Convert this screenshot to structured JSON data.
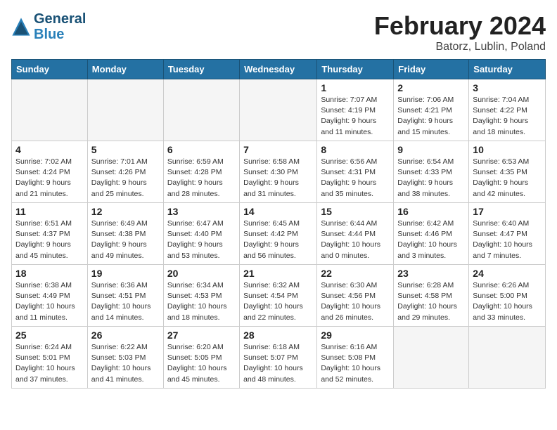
{
  "header": {
    "logo_line1": "General",
    "logo_line2": "Blue",
    "month_title": "February 2024",
    "location": "Batorz, Lublin, Poland"
  },
  "days_of_week": [
    "Sunday",
    "Monday",
    "Tuesday",
    "Wednesday",
    "Thursday",
    "Friday",
    "Saturday"
  ],
  "weeks": [
    [
      {
        "day": "",
        "info": ""
      },
      {
        "day": "",
        "info": ""
      },
      {
        "day": "",
        "info": ""
      },
      {
        "day": "",
        "info": ""
      },
      {
        "day": "1",
        "info": "Sunrise: 7:07 AM\nSunset: 4:19 PM\nDaylight: 9 hours\nand 11 minutes."
      },
      {
        "day": "2",
        "info": "Sunrise: 7:06 AM\nSunset: 4:21 PM\nDaylight: 9 hours\nand 15 minutes."
      },
      {
        "day": "3",
        "info": "Sunrise: 7:04 AM\nSunset: 4:22 PM\nDaylight: 9 hours\nand 18 minutes."
      }
    ],
    [
      {
        "day": "4",
        "info": "Sunrise: 7:02 AM\nSunset: 4:24 PM\nDaylight: 9 hours\nand 21 minutes."
      },
      {
        "day": "5",
        "info": "Sunrise: 7:01 AM\nSunset: 4:26 PM\nDaylight: 9 hours\nand 25 minutes."
      },
      {
        "day": "6",
        "info": "Sunrise: 6:59 AM\nSunset: 4:28 PM\nDaylight: 9 hours\nand 28 minutes."
      },
      {
        "day": "7",
        "info": "Sunrise: 6:58 AM\nSunset: 4:30 PM\nDaylight: 9 hours\nand 31 minutes."
      },
      {
        "day": "8",
        "info": "Sunrise: 6:56 AM\nSunset: 4:31 PM\nDaylight: 9 hours\nand 35 minutes."
      },
      {
        "day": "9",
        "info": "Sunrise: 6:54 AM\nSunset: 4:33 PM\nDaylight: 9 hours\nand 38 minutes."
      },
      {
        "day": "10",
        "info": "Sunrise: 6:53 AM\nSunset: 4:35 PM\nDaylight: 9 hours\nand 42 minutes."
      }
    ],
    [
      {
        "day": "11",
        "info": "Sunrise: 6:51 AM\nSunset: 4:37 PM\nDaylight: 9 hours\nand 45 minutes."
      },
      {
        "day": "12",
        "info": "Sunrise: 6:49 AM\nSunset: 4:38 PM\nDaylight: 9 hours\nand 49 minutes."
      },
      {
        "day": "13",
        "info": "Sunrise: 6:47 AM\nSunset: 4:40 PM\nDaylight: 9 hours\nand 53 minutes."
      },
      {
        "day": "14",
        "info": "Sunrise: 6:45 AM\nSunset: 4:42 PM\nDaylight: 9 hours\nand 56 minutes."
      },
      {
        "day": "15",
        "info": "Sunrise: 6:44 AM\nSunset: 4:44 PM\nDaylight: 10 hours\nand 0 minutes."
      },
      {
        "day": "16",
        "info": "Sunrise: 6:42 AM\nSunset: 4:46 PM\nDaylight: 10 hours\nand 3 minutes."
      },
      {
        "day": "17",
        "info": "Sunrise: 6:40 AM\nSunset: 4:47 PM\nDaylight: 10 hours\nand 7 minutes."
      }
    ],
    [
      {
        "day": "18",
        "info": "Sunrise: 6:38 AM\nSunset: 4:49 PM\nDaylight: 10 hours\nand 11 minutes."
      },
      {
        "day": "19",
        "info": "Sunrise: 6:36 AM\nSunset: 4:51 PM\nDaylight: 10 hours\nand 14 minutes."
      },
      {
        "day": "20",
        "info": "Sunrise: 6:34 AM\nSunset: 4:53 PM\nDaylight: 10 hours\nand 18 minutes."
      },
      {
        "day": "21",
        "info": "Sunrise: 6:32 AM\nSunset: 4:54 PM\nDaylight: 10 hours\nand 22 minutes."
      },
      {
        "day": "22",
        "info": "Sunrise: 6:30 AM\nSunset: 4:56 PM\nDaylight: 10 hours\nand 26 minutes."
      },
      {
        "day": "23",
        "info": "Sunrise: 6:28 AM\nSunset: 4:58 PM\nDaylight: 10 hours\nand 29 minutes."
      },
      {
        "day": "24",
        "info": "Sunrise: 6:26 AM\nSunset: 5:00 PM\nDaylight: 10 hours\nand 33 minutes."
      }
    ],
    [
      {
        "day": "25",
        "info": "Sunrise: 6:24 AM\nSunset: 5:01 PM\nDaylight: 10 hours\nand 37 minutes."
      },
      {
        "day": "26",
        "info": "Sunrise: 6:22 AM\nSunset: 5:03 PM\nDaylight: 10 hours\nand 41 minutes."
      },
      {
        "day": "27",
        "info": "Sunrise: 6:20 AM\nSunset: 5:05 PM\nDaylight: 10 hours\nand 45 minutes."
      },
      {
        "day": "28",
        "info": "Sunrise: 6:18 AM\nSunset: 5:07 PM\nDaylight: 10 hours\nand 48 minutes."
      },
      {
        "day": "29",
        "info": "Sunrise: 6:16 AM\nSunset: 5:08 PM\nDaylight: 10 hours\nand 52 minutes."
      },
      {
        "day": "",
        "info": ""
      },
      {
        "day": "",
        "info": ""
      }
    ]
  ]
}
